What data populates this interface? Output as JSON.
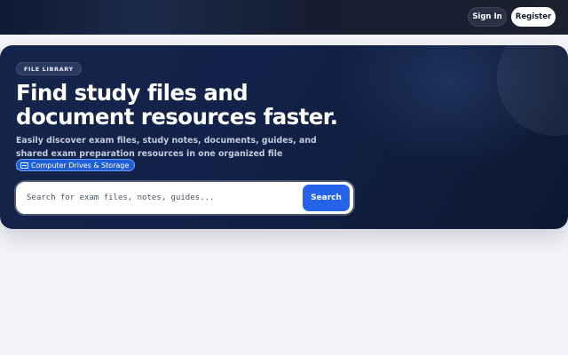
{
  "nav": {
    "signin_label": "Sign In",
    "register_label": "Register"
  },
  "hero": {
    "badge": "FILE LIBRARY",
    "title_line1": "Find study files and",
    "title_line2": "document resources faster.",
    "description": "Easily discover exam files, study notes, documents, guides, and shared exam preparation resources in one organized file library.",
    "tag_label": "Computer Drives & Storage",
    "tag_icon": "drive-icon"
  },
  "search": {
    "placeholder": "Search for exam files, notes, guides...",
    "button_label": "Search"
  },
  "colors": {
    "accent": "#2563eb",
    "hero_bg": "#13224a",
    "page_bg": "#f4f5f9"
  }
}
